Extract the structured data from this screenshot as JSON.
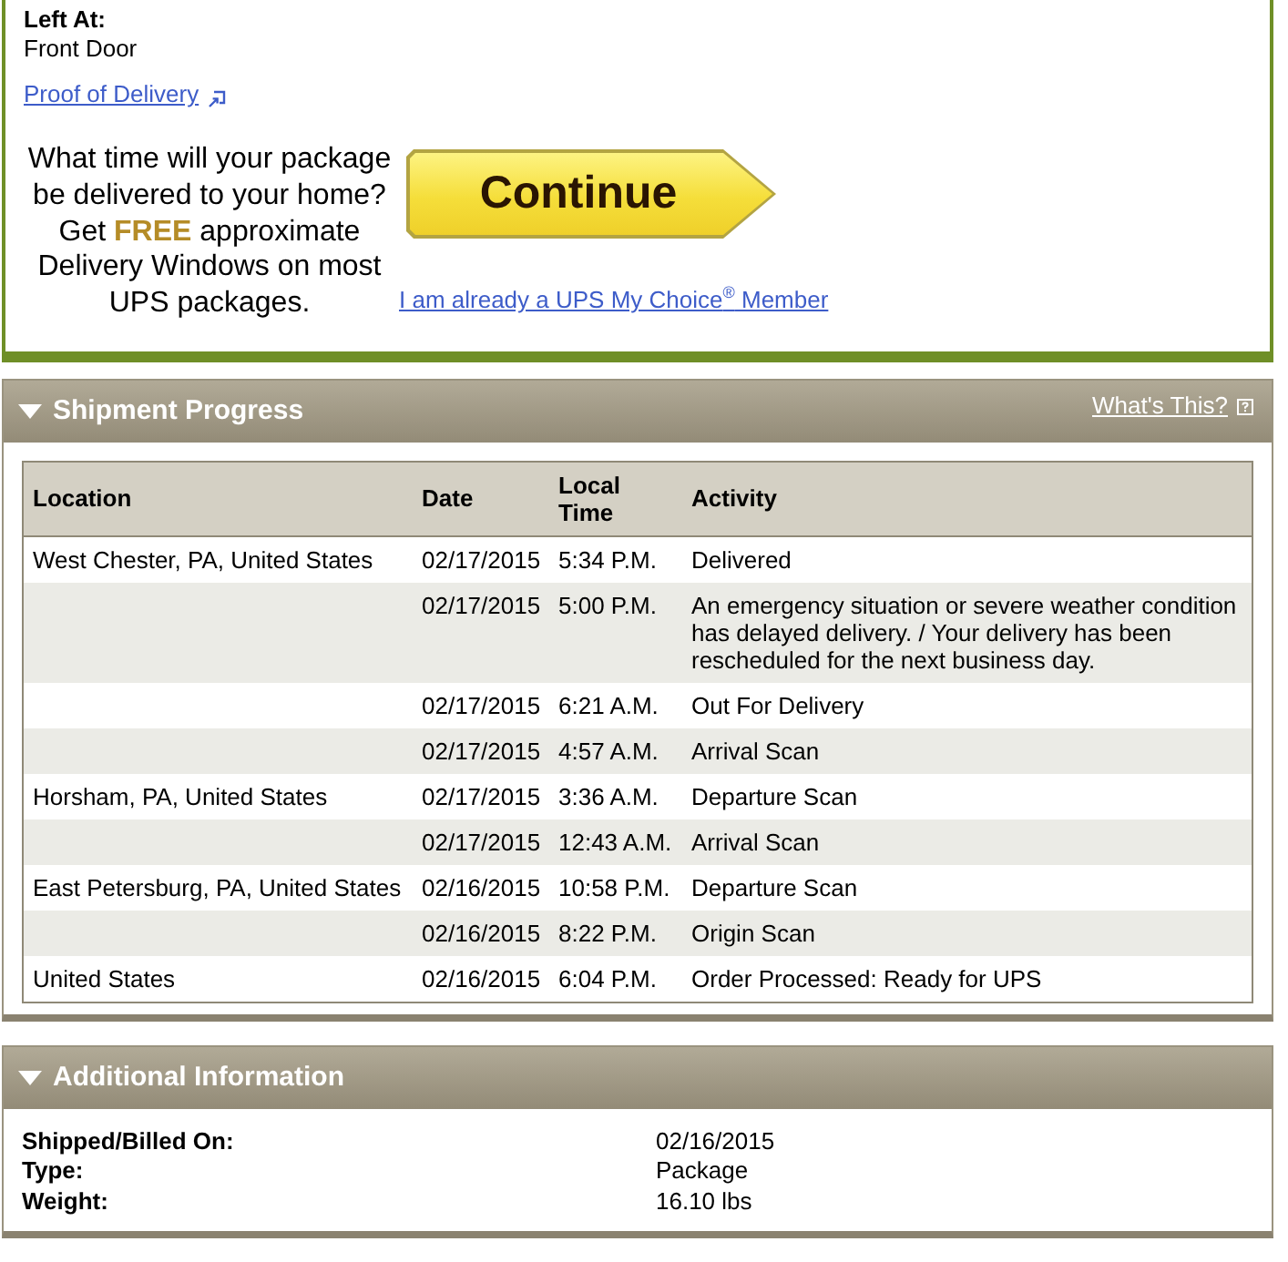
{
  "delivery": {
    "left_at": {
      "label": "Left At:",
      "value": "Front Door"
    },
    "proof_link": "Proof of Delivery"
  },
  "promo": {
    "text": "What time will your package be delivered to your home? Get **FREE** approximate Delivery Windows on most UPS packages.",
    "button": "Continue",
    "member_link": "I am already a UPS My Choice$^{®}$ Member"
  },
  "shipment_progress": {
    "title": "Shipment Progress",
    "expanded": true,
    "help_link": "What's This?",
    "columns": [
      "Location",
      "Date",
      "Local Time",
      "Activity"
    ],
    "rows": [
      {
        "location": "West Chester, PA, United States",
        "date": "02/17/2015",
        "time": "5:34 P.M.",
        "activity": "Delivered"
      },
      {
        "date": "02/17/2015",
        "time": "5:00 P.M.",
        "activity": "An emergency situation or severe weather condition has delayed delivery. / Your delivery has been rescheduled for the next business day."
      },
      {
        "date": "02/17/2015",
        "time": "6:21 A.M.",
        "activity": "Out For Delivery"
      },
      {
        "date": "02/17/2015",
        "time": "4:57 A.M.",
        "activity": "Arrival Scan"
      },
      {
        "location": "Horsham, PA, United States",
        "date": "02/17/2015",
        "time": "3:36 A.M.",
        "activity": "Departure Scan"
      },
      {
        "date": "02/17/2015",
        "time": "12:43 A.M.",
        "activity": "Arrival Scan"
      },
      {
        "location": "East Petersburg, PA, United States",
        "date": "02/16/2015",
        "time": "10:58 P.M.",
        "activity": "Departure Scan"
      },
      {
        "date": "02/16/2015",
        "time": "8:22 P.M.",
        "activity": "Origin Scan"
      },
      {
        "location": "United States",
        "date": "02/16/2015",
        "time": "6:04 P.M.",
        "activity": "Order Processed: Ready for UPS"
      }
    ]
  },
  "additional_information": {
    "title": "Additional Information",
    "expanded": true,
    "fields": [
      {
        "label": "Shipped/Billed On:",
        "value": "02/16/2015"
      },
      {
        "label": "Type:",
        "value": "Package"
      },
      {
        "label": "Weight:",
        "value": "16.10 lbs"
      }
    ]
  }
}
